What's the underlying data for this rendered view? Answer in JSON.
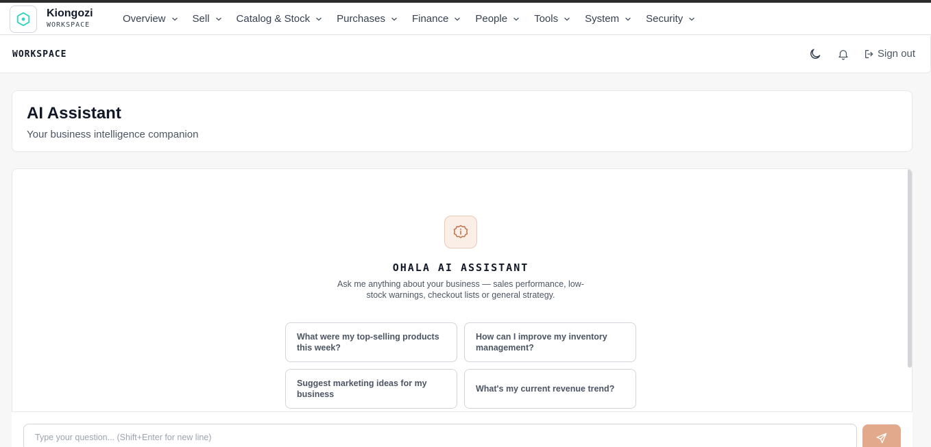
{
  "brand": {
    "name": "Kiongozi",
    "subtitle": "WORKSPACE"
  },
  "nav": [
    {
      "label": "Overview"
    },
    {
      "label": "Sell"
    },
    {
      "label": "Catalog & Stock"
    },
    {
      "label": "Purchases"
    },
    {
      "label": "Finance"
    },
    {
      "label": "People"
    },
    {
      "label": "Tools"
    },
    {
      "label": "System"
    },
    {
      "label": "Security"
    }
  ],
  "subbar": {
    "title": "WORKSPACE",
    "signout_label": "Sign out"
  },
  "page": {
    "title": "AI Assistant",
    "subtitle": "Your business intelligence companion"
  },
  "assistant": {
    "title": "OHALA AI ASSISTANT",
    "description": "Ask me anything about your business — sales performance, low-stock warnings, checkout lists or general strategy.",
    "suggestions": [
      "What were my top-selling products this week?",
      "How can I improve my inventory management?",
      "Suggest marketing ideas for my business",
      "What's my current revenue trend?"
    ]
  },
  "composer": {
    "placeholder": "Type your question... (Shift+Enter for new line)"
  },
  "colors": {
    "accent": "#e2a98c",
    "logo": "#2dd4bf"
  },
  "icons": {
    "logo": "hexagon-icon",
    "theme": "moon-icon",
    "notifications": "bell-icon",
    "signout": "logout-icon",
    "assistant": "info-badge-icon",
    "send": "send-icon"
  }
}
